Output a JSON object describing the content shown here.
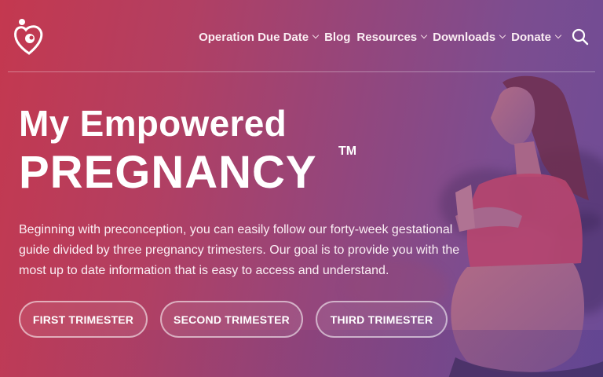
{
  "header": {
    "logo_icon": "heart-family-logo-icon",
    "nav": [
      {
        "label": "Operation Due Date",
        "has_dropdown": true
      },
      {
        "label": "Blog",
        "has_dropdown": false
      },
      {
        "label": "Resources",
        "has_dropdown": true
      },
      {
        "label": "Downloads",
        "has_dropdown": true
      },
      {
        "label": "Donate",
        "has_dropdown": true
      }
    ],
    "search_icon": "search-icon"
  },
  "hero": {
    "title_line1": "My Empowered",
    "title_line2": "PREGNANCY",
    "trademark": "TM",
    "description": "Beginning with preconception, you can easily follow our forty-week gestational guide divided by three pregnancy trimesters. Our goal is to provide you with the most up to date information that is easy to access and understand.",
    "buttons": [
      "FIRST TRIMESTER",
      "SECOND TRIMESTER",
      "THIRD TRIMESTER"
    ]
  },
  "colors": {
    "gradient_start": "#c4384f",
    "gradient_end": "#6d4c96",
    "text": "#ffffff"
  }
}
